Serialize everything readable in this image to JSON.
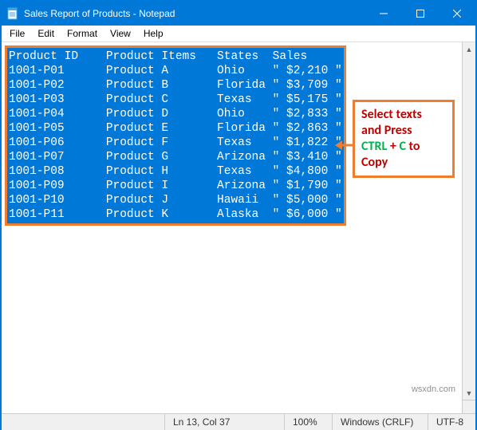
{
  "window": {
    "title": "Sales Report of Products - Notepad"
  },
  "menu": {
    "file": "File",
    "edit": "Edit",
    "format": "Format",
    "view": "View",
    "help": "Help"
  },
  "editor": {
    "header": "Product ID    Product Items   States  Sales",
    "rows": [
      "1001-P01      Product A       Ohio    \" $2,210 \"",
      "1001-P02      Product B       Florida \" $3,709 \"",
      "1001-P03      Product C       Texas   \" $5,175 \"",
      "1001-P04      Product D       Ohio    \" $2,833 \"",
      "1001-P05      Product E       Florida \" $2,863 \"",
      "1001-P06      Product F       Texas   \" $1,822 \"",
      "1001-P07      Product G       Arizona \" $3,410 \"",
      "1001-P08      Product H       Texas   \" $4,800 \"",
      "1001-P09      Product I       Arizona \" $1,790 \"",
      "1001-P10      Product J       Hawaii  \" $5,000 \"",
      "1001-P11      Product K       Alaska  \" $6,000 \""
    ]
  },
  "callout": {
    "l1": "Select texts",
    "l2a": "and Press",
    "l3_a": "CTRL",
    "l3_b": " + ",
    "l3_c": "C",
    "l3_d": " to",
    "l4": "Copy"
  },
  "status": {
    "pos": "Ln 13, Col 37",
    "zoom": "100%",
    "eol": "Windows (CRLF)",
    "enc": "UTF-8"
  },
  "watermark": "wsxdn.com"
}
